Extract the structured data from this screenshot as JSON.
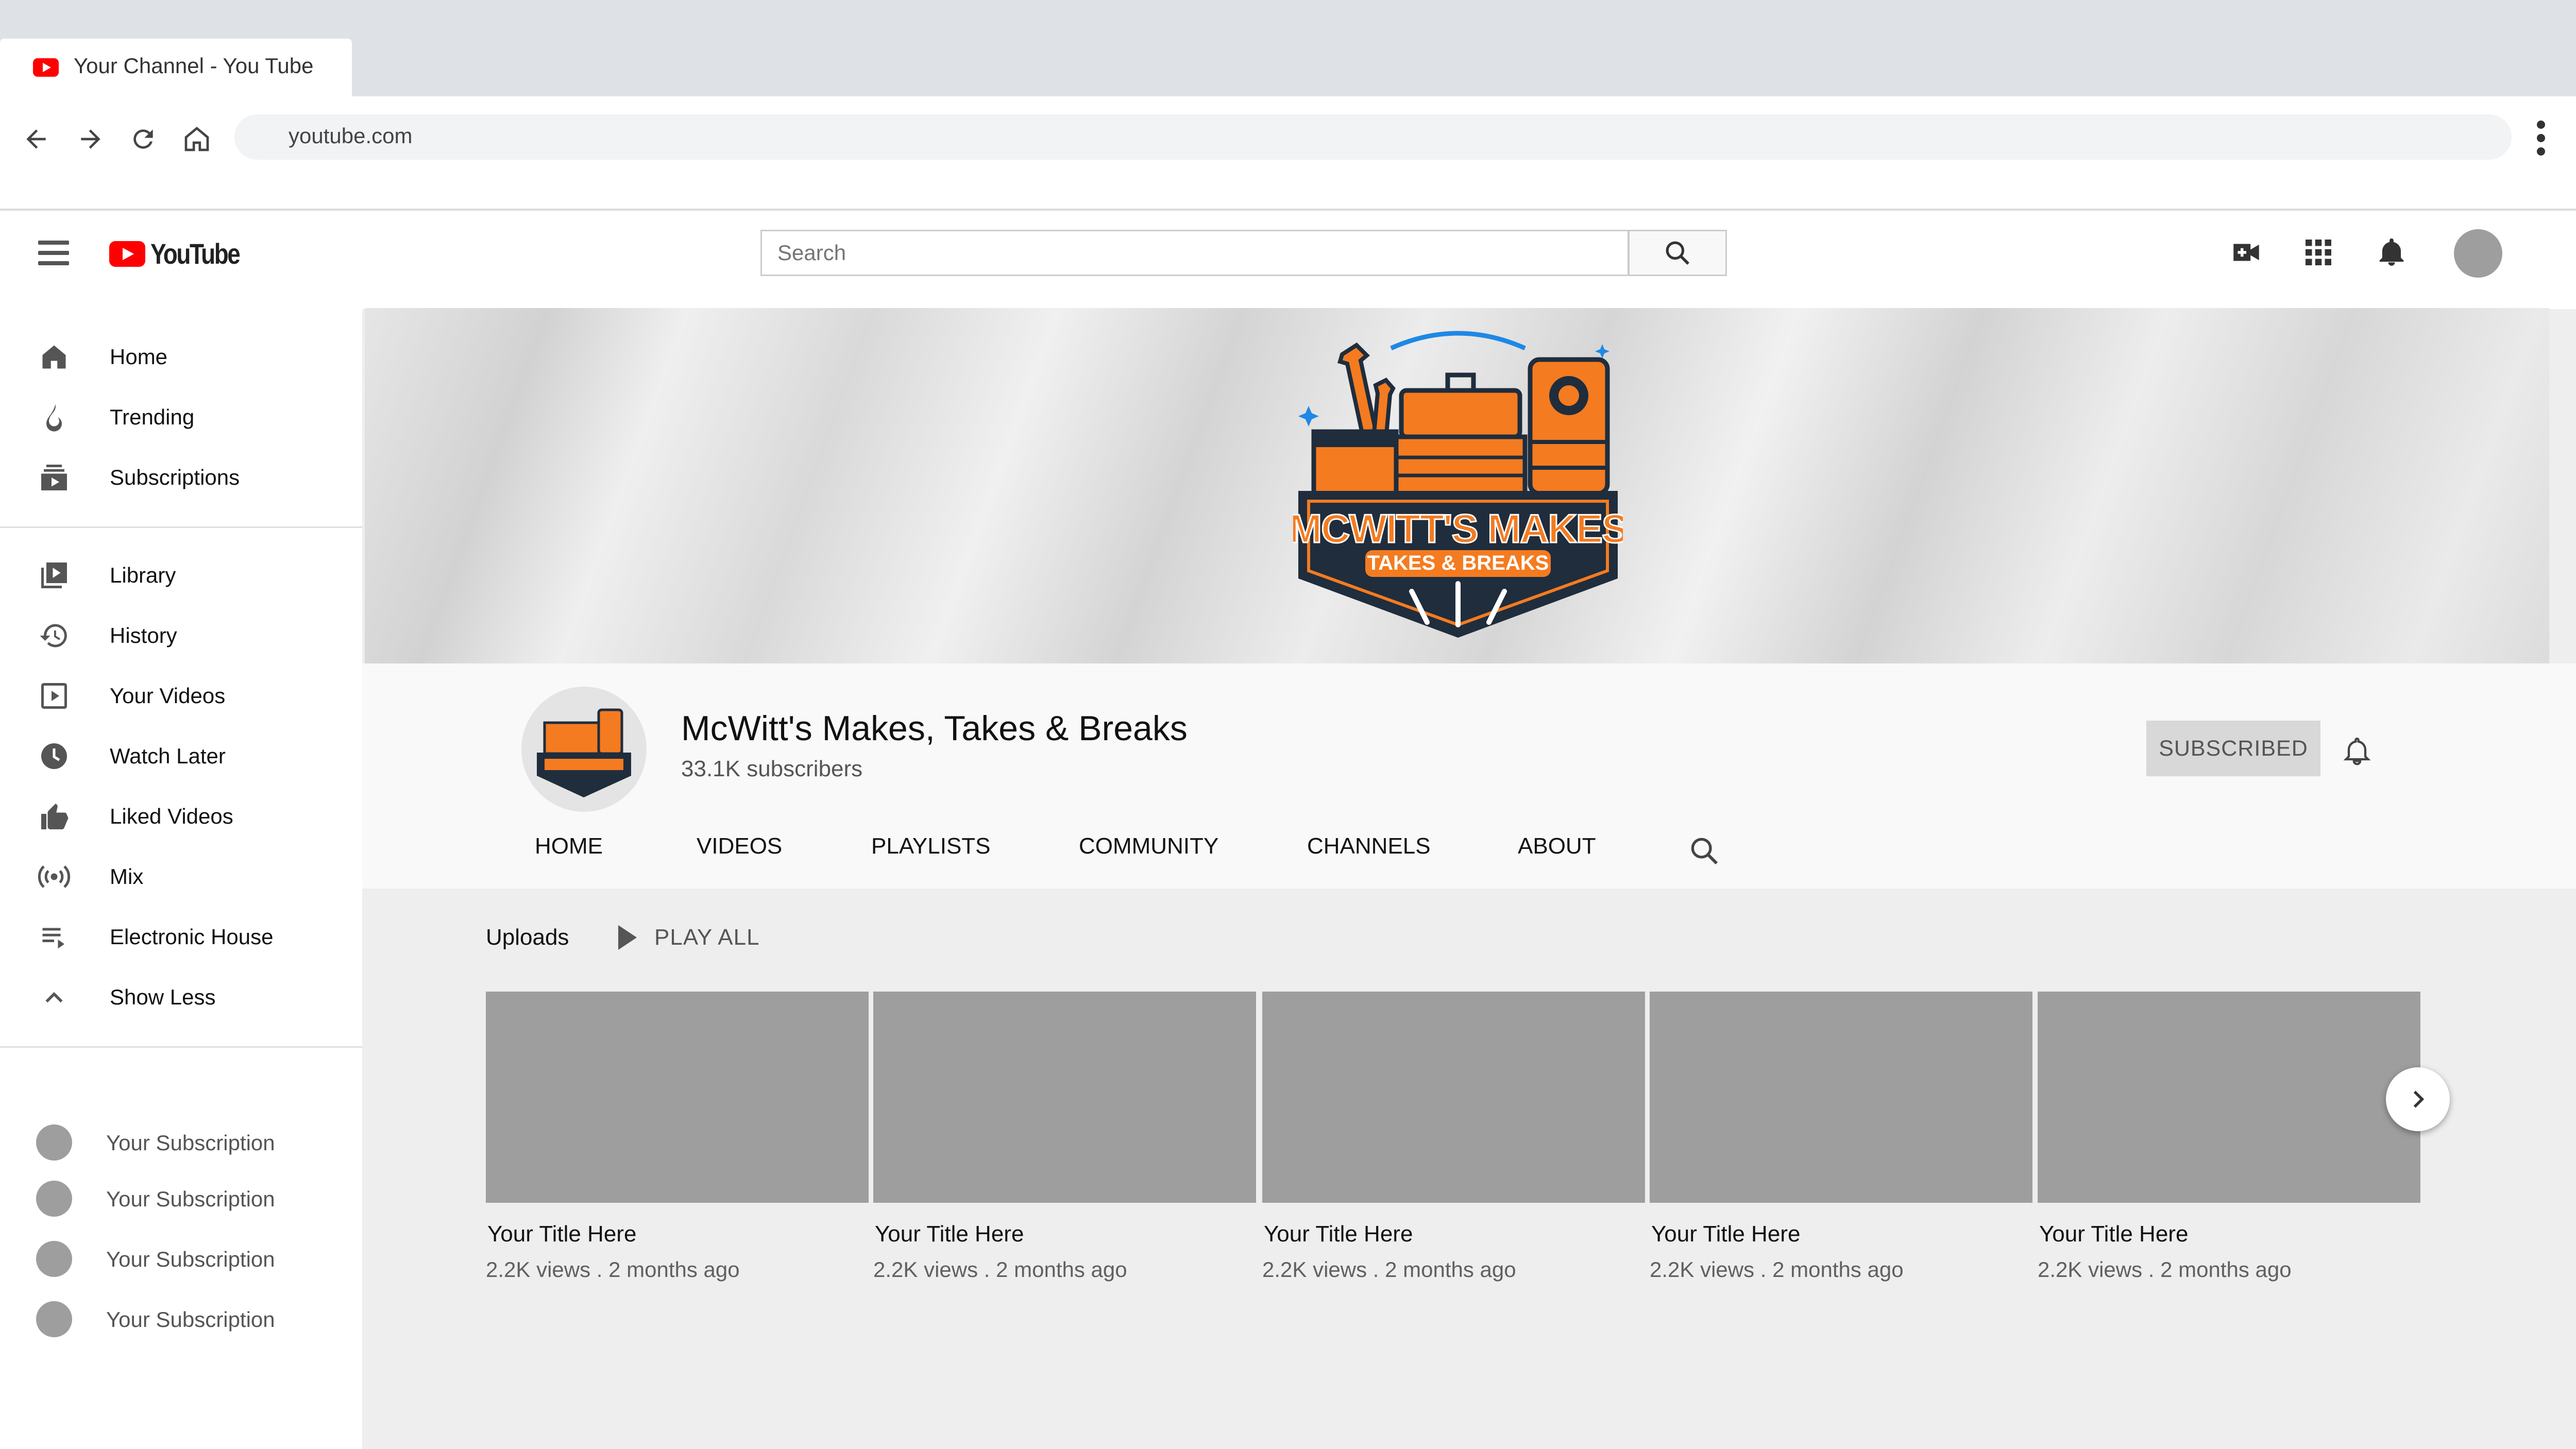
{
  "browser": {
    "tab_title": "Your Channel - You Tube",
    "url": "youtube.com"
  },
  "header": {
    "logo_text": "YouTube",
    "search_placeholder": "Search"
  },
  "sidebar": {
    "primary": [
      {
        "label": "Home",
        "icon": "home-icon"
      },
      {
        "label": "Trending",
        "icon": "flame-icon"
      },
      {
        "label": "Subscriptions",
        "icon": "subscriptions-icon"
      }
    ],
    "library": [
      {
        "label": "Library",
        "icon": "library-icon"
      },
      {
        "label": "History",
        "icon": "history-icon"
      },
      {
        "label": "Your Videos",
        "icon": "play-icon"
      },
      {
        "label": "Watch Later",
        "icon": "clock-icon"
      },
      {
        "label": "Liked Videos",
        "icon": "thumbs-up-icon"
      },
      {
        "label": "Mix",
        "icon": "broadcast-icon"
      },
      {
        "label": "Electronic House",
        "icon": "playlist-icon"
      },
      {
        "label": "Show Less",
        "icon": "chevron-up-icon"
      }
    ],
    "subscriptions": [
      {
        "label": "Your Subscription"
      },
      {
        "label": "Your Subscription"
      },
      {
        "label": "Your Subscription"
      },
      {
        "label": "Your Subscription"
      }
    ]
  },
  "banner": {
    "logo_line1": "MCWITT'S MAKES",
    "logo_line2": "TAKES & BREAKS"
  },
  "channel": {
    "name": "McWitt's Makes, Takes & Breaks",
    "subscribers": "33.1K subscribers",
    "subscribe_label": "SUBSCRIBED",
    "tabs": [
      "HOME",
      "VIDEOS",
      "PLAYLISTS",
      "COMMUNITY",
      "CHANNELS",
      "ABOUT"
    ]
  },
  "uploads": {
    "label": "Uploads",
    "play_all": "PLAY ALL",
    "videos": [
      {
        "title": "Your Title Here",
        "meta": "2.2K views . 2 months ago"
      },
      {
        "title": "Your Title Here",
        "meta": "2.2K views . 2 months ago"
      },
      {
        "title": "Your Title Here",
        "meta": "2.2K views . 2 months ago"
      },
      {
        "title": "Your Title Here",
        "meta": "2.2K views . 2 months ago"
      },
      {
        "title": "Your Title Here",
        "meta": "2.2K views . 2 months ago"
      }
    ]
  },
  "colors": {
    "brand_red": "#ff0000",
    "logo_orange": "#f47b20",
    "logo_navy": "#1f2d3d",
    "thumb_gray": "#9e9e9e"
  }
}
